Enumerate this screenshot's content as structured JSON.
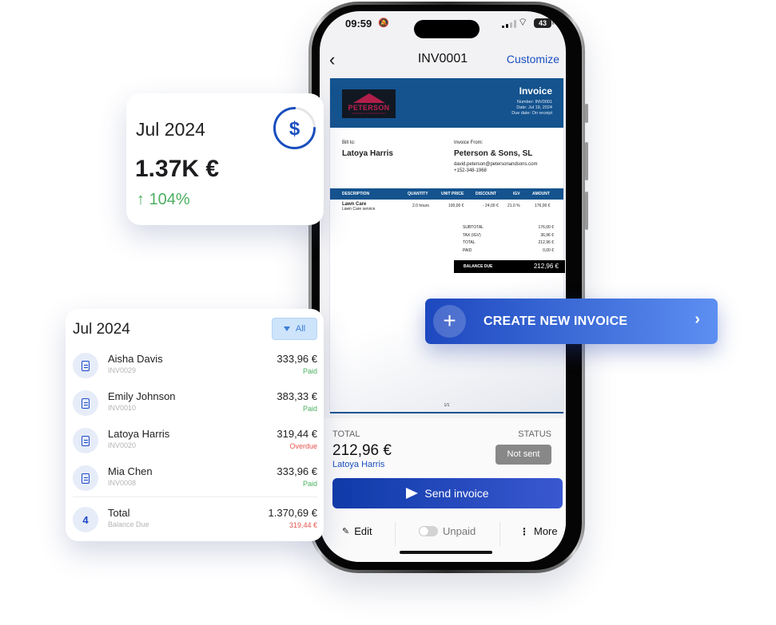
{
  "phone": {
    "status_bar": {
      "time": "09:59",
      "battery": "43"
    },
    "nav": {
      "title": "INV0001",
      "customize_label": "Customize"
    },
    "invoice_preview": {
      "logo": {
        "name": "PETERSON",
        "tagline": "ROOFING & CONSTRUCTION"
      },
      "title": "Invoice",
      "number": "Number: INV0001",
      "date": "Date: Jul 19, 2024",
      "due_date": "Due date: On receipt",
      "bill_to_label": "Bill to:",
      "bill_to_name": "Latoya Harris",
      "from_label": "Invoice From:",
      "from_name": "Peterson & Sons, SL",
      "from_email": "david.peterson@petersonandsons.com",
      "from_phone": "+152-348-1968",
      "columns": [
        "DESCRIPTION",
        "QUANTITY",
        "UNIT PRICE",
        "DISCOUNT",
        "IGV",
        "AMOUNT"
      ],
      "items": [
        {
          "title": "Lawn Care",
          "subtitle": "Lawn Care service",
          "quantity": "2.0 hours",
          "unit_price": "100,00 €",
          "discount": "- 24,00 €",
          "igv": "21.0 %",
          "amount": "176,00 €"
        }
      ],
      "totals": [
        {
          "label": "SUBTOTAL",
          "value": "176,00 €"
        },
        {
          "label": "TAX (IGV)",
          "value": "36,96 €"
        },
        {
          "label": "TOTAL",
          "value": "212,96 €"
        },
        {
          "label": "PAID",
          "value": "0,00 €"
        }
      ],
      "balance_due_label": "BALANCE DUE",
      "balance_due_value": "212,96 €",
      "page": "1/1"
    },
    "summary": {
      "total_label": "TOTAL",
      "total_value": "212,96 €",
      "client": "Latoya Harris",
      "status_label": "STATUS",
      "status_value": "Not sent"
    },
    "send_button_label": "Send invoice",
    "actions": {
      "edit": "Edit",
      "paid_toggle": "Unpaid",
      "more": "More"
    }
  },
  "stat_card": {
    "month": "Jul 2024",
    "value": "1.37K €",
    "change": "104%",
    "change_direction": "up",
    "ring_progress": 0.75
  },
  "list_card": {
    "month": "Jul 2024",
    "filter_label": "All",
    "items": [
      {
        "name": "Aisha Davis",
        "id": "INV0029",
        "amount": "333,96 €",
        "status": "Paid"
      },
      {
        "name": "Emily Johnson",
        "id": "INV0010",
        "amount": "383,33 €",
        "status": "Paid"
      },
      {
        "name": "Latoya Harris",
        "id": "INV0020",
        "amount": "319,44 €",
        "status": "Overdue"
      },
      {
        "name": "Mia Chen",
        "id": "INV0008",
        "amount": "333,96 €",
        "status": "Paid"
      }
    ],
    "total": {
      "count": "4",
      "label": "Total",
      "sublabel": "Balance Due",
      "amount": "1.370,69 €",
      "due": "319,44 €"
    }
  },
  "create_button_label": "CREATE NEW INVOICE",
  "colors": {
    "brand_blue": "#1d48c9",
    "invoice_header": "#14538e",
    "paid": "#4caf60",
    "overdue": "#e5534b",
    "status_not_sent": "#888888"
  }
}
